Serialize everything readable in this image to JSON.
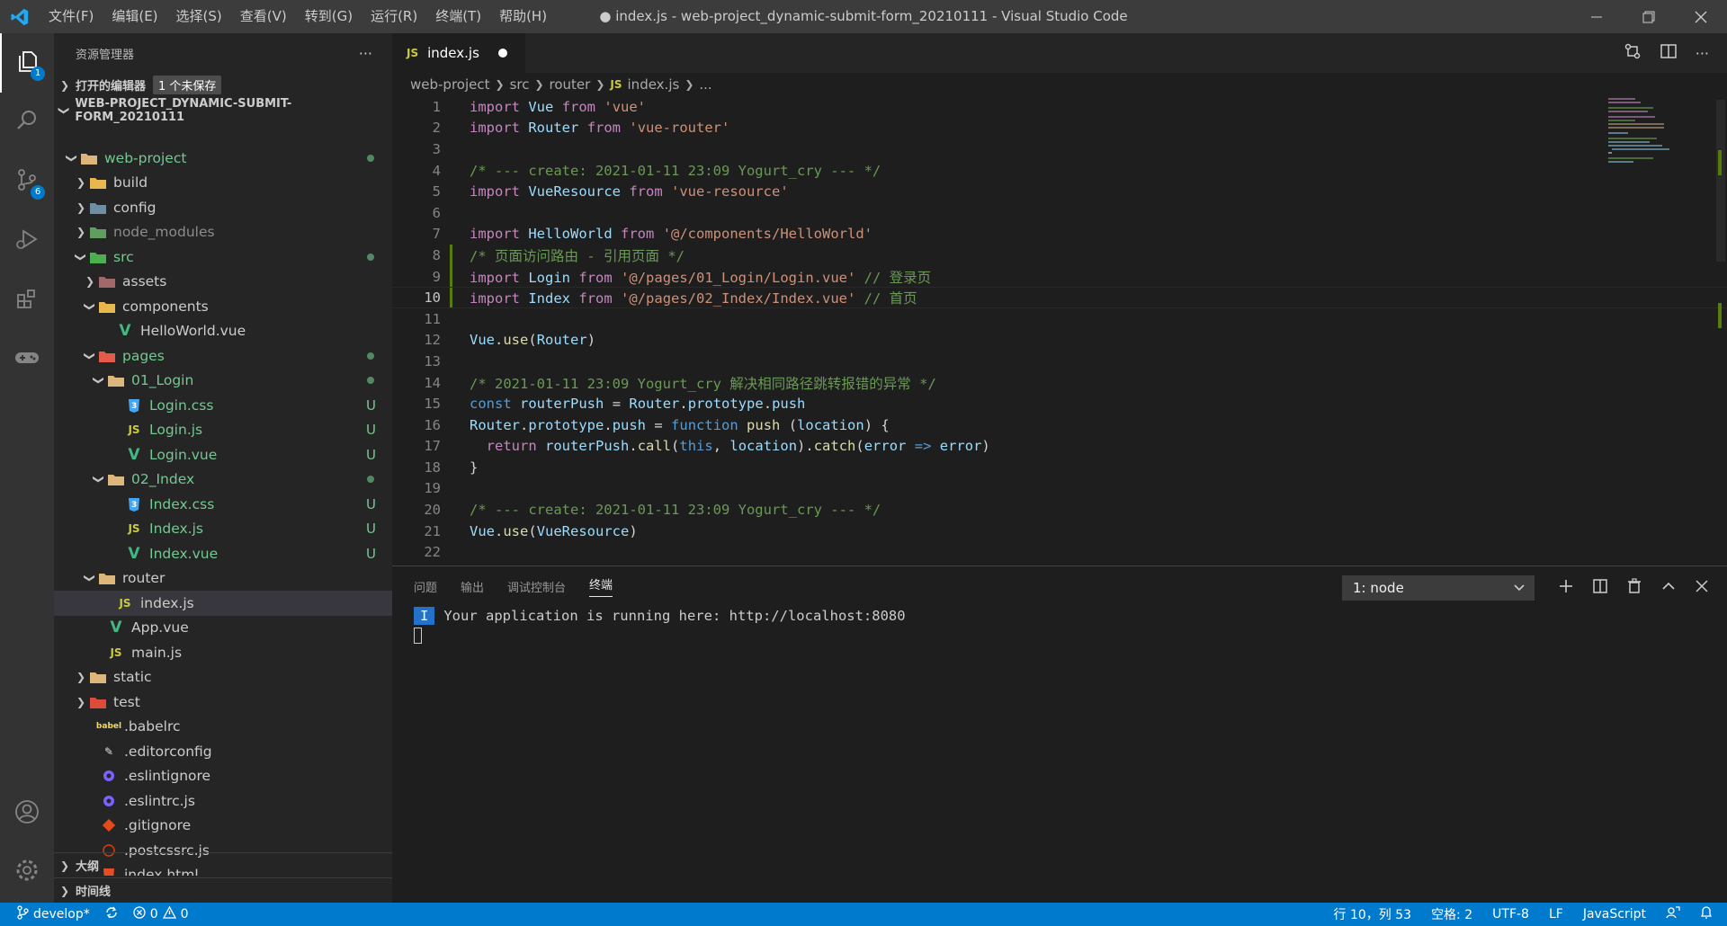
{
  "window": {
    "title": "● index.js - web-project_dynamic-submit-form_20210111 - Visual Studio Code",
    "menu": [
      "文件(F)",
      "编辑(E)",
      "选择(S)",
      "查看(V)",
      "转到(G)",
      "运行(R)",
      "终端(T)",
      "帮助(H)"
    ]
  },
  "activity": {
    "explorer_badge": "1",
    "scm_badge": "6"
  },
  "sidebar": {
    "title": "资源管理器",
    "more": "···",
    "open_editors": "打开的编辑器",
    "unsaved": "1 个未保存",
    "project": "WEB-PROJECT_DYNAMIC-SUBMIT-FORM_20210111",
    "tree": [
      {
        "label": "web-project",
        "git": ""
      },
      {
        "label": "build",
        "git": ""
      },
      {
        "label": "config",
        "git": ""
      },
      {
        "label": "node_modules",
        "git": ""
      },
      {
        "label": "src",
        "git": ""
      },
      {
        "label": "assets",
        "git": ""
      },
      {
        "label": "components",
        "git": ""
      },
      {
        "label": "HelloWorld.vue",
        "git": ""
      },
      {
        "label": "pages",
        "git": ""
      },
      {
        "label": "01_Login",
        "git": ""
      },
      {
        "label": "Login.css",
        "git": "U"
      },
      {
        "label": "Login.js",
        "git": "U"
      },
      {
        "label": "Login.vue",
        "git": "U"
      },
      {
        "label": "02_Index",
        "git": ""
      },
      {
        "label": "Index.css",
        "git": "U"
      },
      {
        "label": "Index.js",
        "git": "U"
      },
      {
        "label": "Index.vue",
        "git": "U"
      },
      {
        "label": "router",
        "git": ""
      },
      {
        "label": "index.js",
        "git": ""
      },
      {
        "label": "App.vue",
        "git": ""
      },
      {
        "label": "main.js",
        "git": ""
      },
      {
        "label": "static",
        "git": ""
      },
      {
        "label": "test",
        "git": ""
      },
      {
        "label": ".babelrc",
        "git": ""
      },
      {
        "label": ".editorconfig",
        "git": ""
      },
      {
        "label": ".eslintignore",
        "git": ""
      },
      {
        "label": ".eslintrc.js",
        "git": ""
      },
      {
        "label": ".gitignore",
        "git": ""
      },
      {
        "label": ".postcssrc.js",
        "git": ""
      },
      {
        "label": "index.html",
        "git": ""
      }
    ],
    "outline": "大纲",
    "timeline": "时间线"
  },
  "editor": {
    "tab_label": "index.js",
    "tab_badge": "JS",
    "breadcrumb": [
      "web-project",
      "src",
      "router",
      "index.js",
      "..."
    ],
    "line_numbers": [
      "1",
      "2",
      "3",
      "4",
      "5",
      "6",
      "7",
      "8",
      "9",
      "10",
      "11",
      "12",
      "13",
      "14",
      "15",
      "16",
      "17",
      "18",
      "19",
      "20",
      "21",
      "22"
    ],
    "code": {
      "l1": [
        "import",
        "Vue",
        "from",
        "'vue'"
      ],
      "l2": [
        "import",
        "Router",
        "from",
        "'vue-router'"
      ],
      "l4": "/* --- create: 2021-01-11 23:09 Yogurt_cry --- */",
      "l5": [
        "import",
        "VueResource",
        "from",
        "'vue-resource'"
      ],
      "l7": [
        "import",
        "HelloWorld",
        "from",
        "'@/components/HelloWorld'"
      ],
      "l8": "/* 页面访问路由 - 引用页面 */",
      "l9": [
        "import",
        "Login",
        "from",
        "'@/pages/01_Login/Login.vue'",
        "// 登录页"
      ],
      "l10": [
        "import",
        "Index",
        "from",
        "'@/pages/02_Index/Index.vue'",
        "// 首页"
      ],
      "l12": [
        "Vue",
        ".",
        "use",
        "(",
        "Router",
        ")"
      ],
      "l14": "/* 2021-01-11 23:09 Yogurt_cry 解决相同路径跳转报错的异常 */",
      "l15": [
        "const",
        "routerPush",
        "=",
        "Router",
        ".",
        "prototype",
        ".",
        "push"
      ],
      "l16": [
        "Router",
        ".",
        "prototype",
        ".",
        "push",
        "=",
        "function",
        "push",
        "(",
        "location",
        ") {"
      ],
      "l17": [
        "return",
        "routerPush",
        ".",
        "call",
        "(",
        "this",
        ",",
        "location",
        ").",
        "catch",
        "(",
        "error",
        "=>",
        "error",
        ")"
      ],
      "l18": "}",
      "l20": "/* --- create: 2021-01-11 23:09 Yogurt_cry --- */",
      "l21": [
        "Vue",
        ".",
        "use",
        "(",
        "VueResource",
        ")"
      ]
    }
  },
  "panel": {
    "tabs": [
      "问题",
      "输出",
      "调试控制台",
      "终端"
    ],
    "terminal_select": "1: node",
    "term_prefix": "I",
    "term_output": "Your application is running here: http://localhost:8080"
  },
  "status": {
    "branch": "develop*",
    "errors": "0",
    "warnings": "0",
    "position": "行 10，列 53",
    "spaces": "空格: 2",
    "encoding": "UTF-8",
    "eol": "LF",
    "language": "JavaScript"
  },
  "colors": {
    "accent": "#007acc",
    "untracked": "#73c991",
    "js_icon": "#cbcb41",
    "vue_icon": "#41b883",
    "css_icon": "#42a5f5"
  }
}
